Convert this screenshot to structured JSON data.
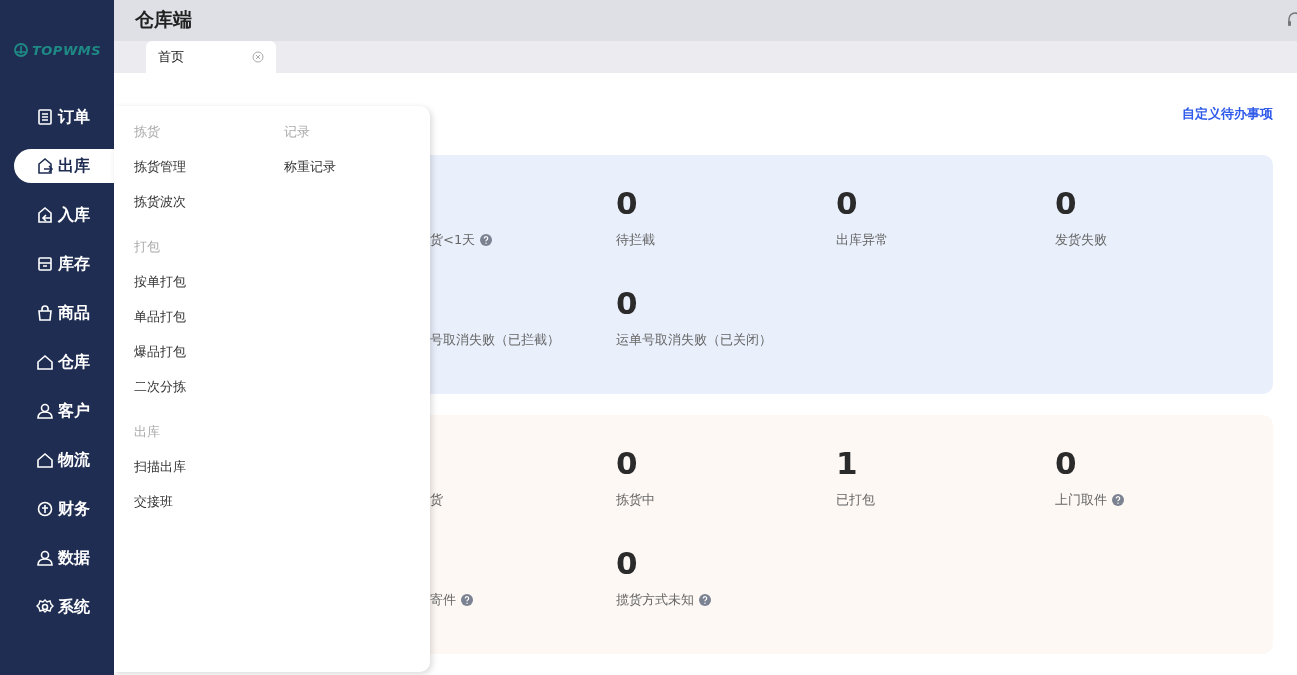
{
  "sidebar": {
    "logo": "TOPWMS",
    "items": [
      {
        "label": "订单",
        "selected": false
      },
      {
        "label": "出库",
        "selected": true
      },
      {
        "label": "入库",
        "selected": false
      },
      {
        "label": "库存",
        "selected": false
      },
      {
        "label": "商品",
        "selected": false
      },
      {
        "label": "仓库",
        "selected": false
      },
      {
        "label": "客户",
        "selected": false
      },
      {
        "label": "物流",
        "selected": false
      },
      {
        "label": "财务",
        "selected": false
      },
      {
        "label": "数据",
        "selected": false
      },
      {
        "label": "系统",
        "selected": false
      }
    ]
  },
  "header": {
    "title": "仓库端"
  },
  "tabs": [
    {
      "label": "首页",
      "selected": true
    }
  ],
  "dashboard": {
    "link": "自定义待办事项",
    "cards": [
      {
        "kind": "blue",
        "rows": [
          [
            {
              "label": "货<1天",
              "help": true
            },
            {
              "value": "0",
              "label": "待拦截",
              "help": false
            },
            {
              "value": "0",
              "label": "出库异常",
              "help": false
            },
            {
              "value": "0",
              "label": "发货失败",
              "help": false
            }
          ],
          [
            {
              "label": "号取消失败（已拦截）",
              "help": false
            },
            {
              "value": "0",
              "label": "运单号取消失败（已关闭）",
              "help": false
            }
          ]
        ]
      },
      {
        "kind": "orange",
        "rows": [
          [
            {
              "label": "货",
              "help": false
            },
            {
              "value": "0",
              "label": "拣货中",
              "help": false
            },
            {
              "value": "1",
              "label": "已打包",
              "help": false
            },
            {
              "value": "0",
              "label": "上门取件",
              "help": true
            }
          ],
          [
            {
              "label": "寄件",
              "help": true
            },
            {
              "value": "0",
              "label": "揽货方式未知",
              "help": true
            }
          ]
        ]
      }
    ]
  },
  "menu": {
    "rows": [
      [
        {
          "title": "拣货",
          "items": [
            "拣货管理",
            "拣货波次"
          ]
        },
        {
          "title": "记录",
          "items": [
            "称重记录"
          ]
        }
      ],
      [
        {
          "title": "打包",
          "items": [
            "按单打包",
            "单品打包",
            "爆品打包",
            "二次分拣"
          ]
        }
      ],
      [
        {
          "title": "出库",
          "items": [
            "扫描出库",
            "交接班"
          ]
        }
      ]
    ]
  }
}
